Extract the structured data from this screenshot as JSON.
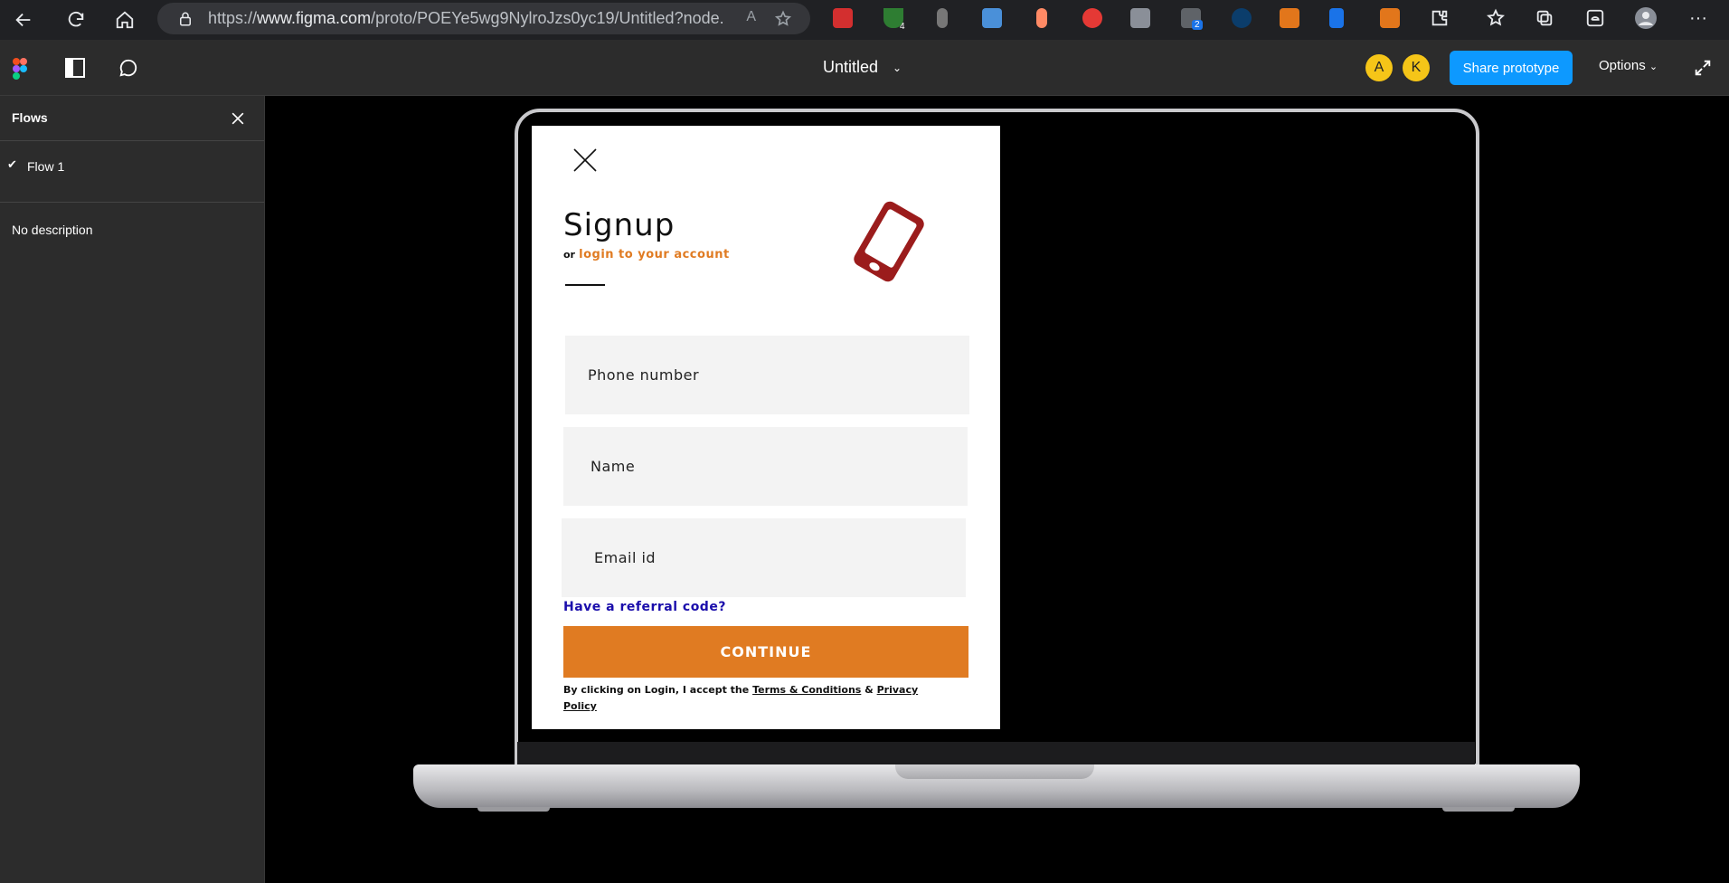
{
  "browser": {
    "url_prefix": "https://",
    "url_host": "www.figma.com",
    "url_path": "/proto/POEYe5wg9NylroJzs0yc19/Untitled?node...",
    "read_aloud": "A",
    "ext_badge_1": "4",
    "ext_badge_2": "2"
  },
  "figma": {
    "doc_title": "Untitled",
    "avatars": [
      "A",
      "K"
    ],
    "share_label": "Share prototype",
    "options_label": "Options"
  },
  "sidebar": {
    "title": "Flows",
    "flow_label": "Flow 1",
    "description": "No description"
  },
  "screen": {
    "title": "Signup",
    "or_text": "or",
    "login_link": "login to your account",
    "phone_placeholder": "Phone number",
    "name_placeholder": "Name",
    "email_placeholder": "Email id",
    "referral": "Have a referral code?",
    "continue_label": "CONTINUE",
    "terms_prefix": "By clicking on Login, I accept the",
    "terms_link": "Terms & Conditions",
    "terms_amp": "&",
    "privacy_link": "Privacy Policy"
  },
  "colors": {
    "accent": "#e07b22",
    "figma_blue": "#0d99ff",
    "link_blue": "#1a0dab",
    "phone_icon_red": "#9b1c1c"
  }
}
